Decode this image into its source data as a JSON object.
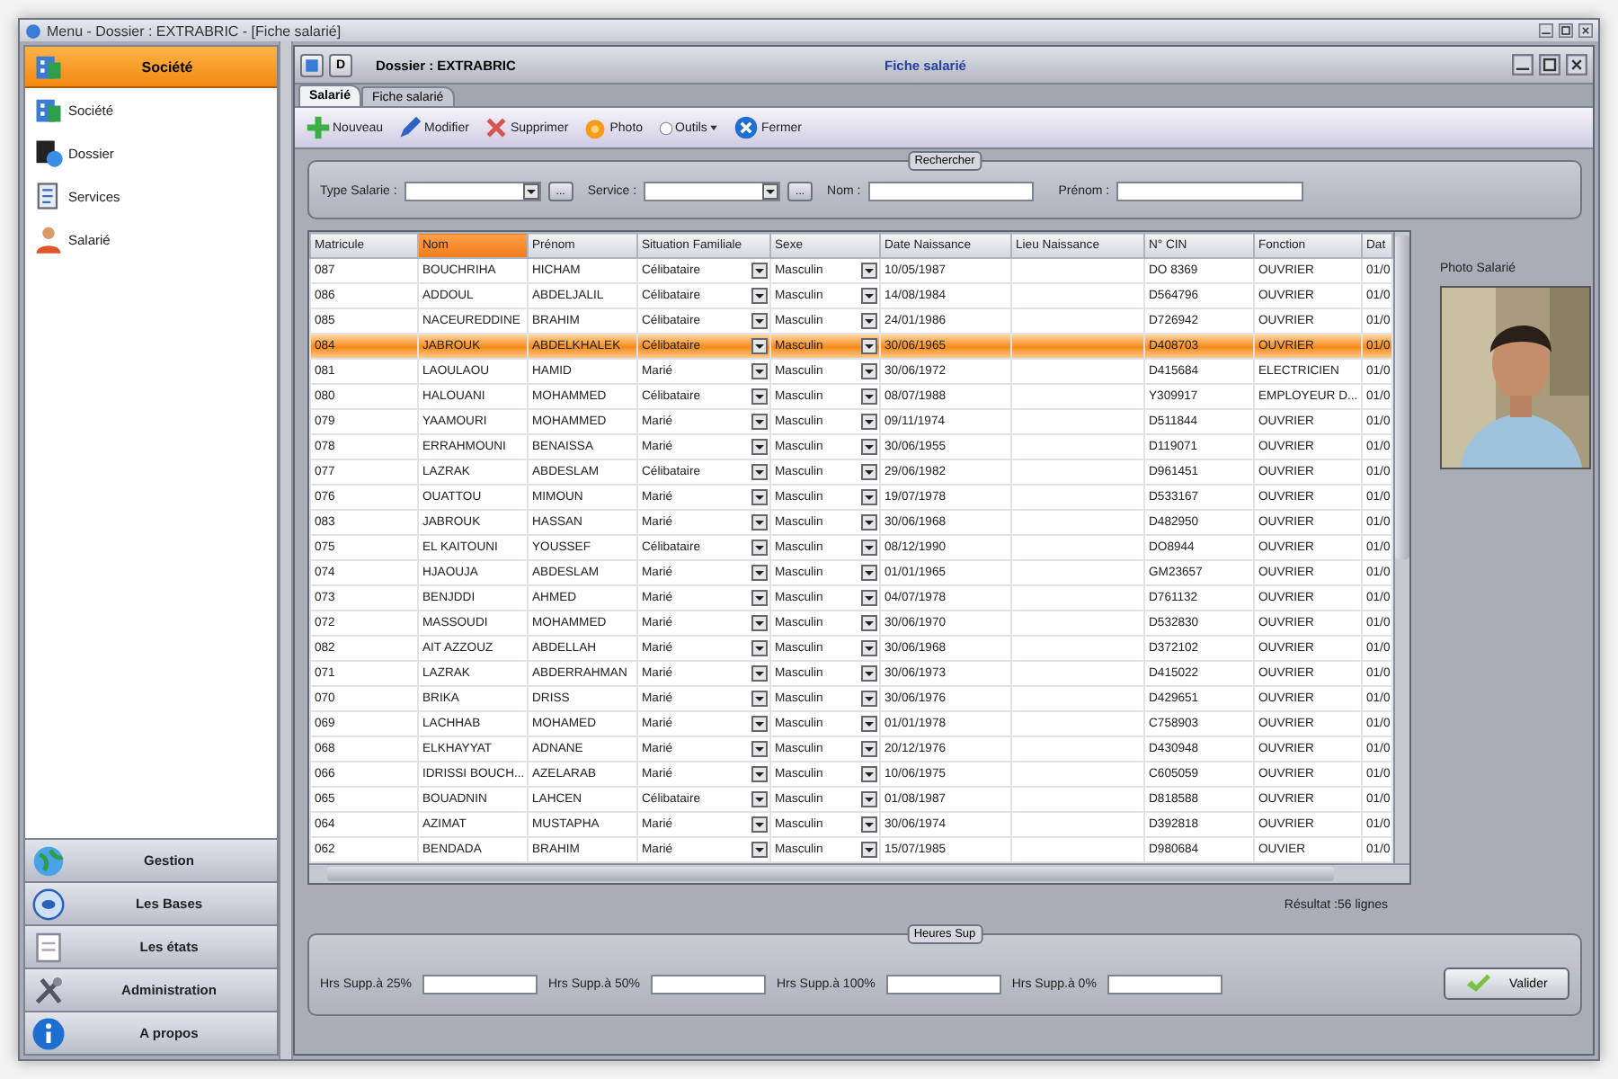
{
  "window": {
    "title": "Menu - Dossier : EXTRABRIC - [Fiche salarié]"
  },
  "sidebar": {
    "header": {
      "label": "Société",
      "selected": true
    },
    "items": [
      "Société",
      "Dossier",
      "Services",
      "Salarié"
    ],
    "nav": [
      "Gestion",
      "Les Bases",
      "Les états",
      "Administration",
      "A propos"
    ]
  },
  "document": {
    "button": "D",
    "dossier": "Dossier : EXTRABRIC",
    "title": "Fiche salarié"
  },
  "tabs": [
    {
      "label": "Salarié",
      "selected": true
    },
    {
      "label": "Fiche salarié",
      "selected": false
    }
  ],
  "toolbar": [
    {
      "label": "Nouveau",
      "kind": "button"
    },
    {
      "label": "Modifier",
      "kind": "button"
    },
    {
      "label": "Supprimer",
      "kind": "button"
    },
    {
      "label": "Photo",
      "kind": "button"
    },
    {
      "label": "Outils",
      "kind": "menu"
    },
    {
      "label": "Fermer",
      "kind": "button"
    }
  ],
  "search": {
    "title": "Rechercher",
    "fields": [
      {
        "label": "Type Salarie :",
        "kind": "combo",
        "browse": "..."
      },
      {
        "label": "Service :",
        "kind": "combo",
        "browse": "..."
      },
      {
        "label": "Nom :",
        "kind": "text"
      },
      {
        "label": "Prénom :",
        "kind": "text"
      }
    ]
  },
  "table": {
    "columns": [
      {
        "label": "Matricule",
        "sorted": false,
        "kind": "text"
      },
      {
        "label": "Nom",
        "sorted": true,
        "kind": "text"
      },
      {
        "label": "Prénom",
        "sorted": false,
        "kind": "text"
      },
      {
        "label": "Situation Familiale",
        "sorted": false,
        "kind": "combo"
      },
      {
        "label": "Sexe",
        "sorted": false,
        "kind": "combo"
      },
      {
        "label": "Date Naissance",
        "sorted": false,
        "kind": "text"
      },
      {
        "label": "Lieu Naissance",
        "sorted": false,
        "kind": "text"
      },
      {
        "label": "N° CIN",
        "sorted": false,
        "kind": "text"
      },
      {
        "label": "Fonction",
        "sorted": false,
        "kind": "text"
      },
      {
        "label": "Dat",
        "sorted": false,
        "kind": "text"
      }
    ],
    "rows": [
      {
        "selected": false,
        "cells": [
          "087",
          "BOUCHRIHA",
          "HICHAM",
          "Célibataire",
          "Masculin",
          "10/05/1987",
          "",
          "DO 8369",
          "OUVRIER",
          "01/0"
        ]
      },
      {
        "selected": false,
        "cells": [
          "086",
          "ADDOUL",
          "ABDELJALIL",
          "Célibataire",
          "Masculin",
          "14/08/1984",
          "",
          "D564796",
          "OUVRIER",
          "01/0"
        ]
      },
      {
        "selected": false,
        "cells": [
          "085",
          "NACEUREDDINE",
          "BRAHIM",
          "Célibataire",
          "Masculin",
          "24/01/1986",
          "",
          "D726942",
          "OUVRIER",
          "01/0"
        ]
      },
      {
        "selected": true,
        "cells": [
          "084",
          "JABROUK",
          "ABDELKHALEK",
          "Célibataire",
          "Masculin",
          "30/06/1965",
          "",
          "D408703",
          "OUVRIER",
          "01/0"
        ]
      },
      {
        "selected": false,
        "cells": [
          "081",
          "LAOULAOU",
          "HAMID",
          "Marié",
          "Masculin",
          "30/06/1972",
          "",
          "D415684",
          "ELECTRICIEN",
          "01/0"
        ]
      },
      {
        "selected": false,
        "cells": [
          "080",
          "HALOUANI",
          "MOHAMMED",
          "Célibataire",
          "Masculin",
          "08/07/1988",
          "",
          "Y309917",
          "EMPLOYEUR D...",
          "01/0"
        ]
      },
      {
        "selected": false,
        "cells": [
          "079",
          "YAAMOURI",
          "MOHAMMED",
          "Marié",
          "Masculin",
          "09/11/1974",
          "",
          "D511844",
          "OUVRIER",
          "01/0"
        ]
      },
      {
        "selected": false,
        "cells": [
          "078",
          "ERRAHMOUNI",
          "BENAISSA",
          "Marié",
          "Masculin",
          "30/06/1955",
          "",
          "D119071",
          "OUVRIER",
          "01/0"
        ]
      },
      {
        "selected": false,
        "cells": [
          "077",
          "LAZRAK",
          "ABDESLAM",
          "Célibataire",
          "Masculin",
          "29/06/1982",
          "",
          "D961451",
          "OUVRIER",
          "01/0"
        ]
      },
      {
        "selected": false,
        "cells": [
          "076",
          "OUATTOU",
          "MIMOUN",
          "Marié",
          "Masculin",
          "19/07/1978",
          "",
          "D533167",
          "OUVRIER",
          "01/0"
        ]
      },
      {
        "selected": false,
        "cells": [
          "083",
          "JABROUK",
          "HASSAN",
          "Marié",
          "Masculin",
          "30/06/1968",
          "",
          "D482950",
          "OUVRIER",
          "01/0"
        ]
      },
      {
        "selected": false,
        "cells": [
          "075",
          "EL KAITOUNI",
          "YOUSSEF",
          "Célibataire",
          "Masculin",
          "08/12/1990",
          "",
          "DO8944",
          "OUVRIER",
          "01/0"
        ]
      },
      {
        "selected": false,
        "cells": [
          "074",
          "HJAOUJA",
          "ABDESLAM",
          "Marié",
          "Masculin",
          "01/01/1965",
          "",
          "GM23657",
          "OUVRIER",
          "01/0"
        ]
      },
      {
        "selected": false,
        "cells": [
          "073",
          "BENJDDI",
          "AHMED",
          "Marié",
          "Masculin",
          "04/07/1978",
          "",
          "D761132",
          "OUVRIER",
          "01/0"
        ]
      },
      {
        "selected": false,
        "cells": [
          "072",
          "MASSOUDI",
          "MOHAMMED",
          "Marié",
          "Masculin",
          "30/06/1970",
          "",
          "D532830",
          "OUVRIER",
          "01/0"
        ]
      },
      {
        "selected": false,
        "cells": [
          "082",
          "AIT AZZOUZ",
          "ABDELLAH",
          "Marié",
          "Masculin",
          "30/06/1968",
          "",
          "D372102",
          "OUVRIER",
          "01/0"
        ]
      },
      {
        "selected": false,
        "cells": [
          "071",
          "LAZRAK",
          "ABDERRAHMAN",
          "Marié",
          "Masculin",
          "30/06/1973",
          "",
          "D415022",
          "OUVRIER",
          "01/0"
        ]
      },
      {
        "selected": false,
        "cells": [
          "070",
          "BRIKA",
          "DRISS",
          "Marié",
          "Masculin",
          "30/06/1976",
          "",
          "D429651",
          "OUVRIER",
          "01/0"
        ]
      },
      {
        "selected": false,
        "cells": [
          "069",
          "LACHHAB",
          "MOHAMED",
          "Marié",
          "Masculin",
          "01/01/1978",
          "",
          "C758903",
          "OUVRIER",
          "01/0"
        ]
      },
      {
        "selected": false,
        "cells": [
          "068",
          "ELKHAYYAT",
          "ADNANE",
          "Marié",
          "Masculin",
          "20/12/1976",
          "",
          "D430948",
          "OUVRIER",
          "01/0"
        ]
      },
      {
        "selected": false,
        "cells": [
          "066",
          "IDRISSI BOUCH...",
          "AZELARAB",
          "Marié",
          "Masculin",
          "10/06/1975",
          "",
          "C605059",
          "OUVRIER",
          "01/0"
        ]
      },
      {
        "selected": false,
        "cells": [
          "065",
          "BOUADNIN",
          "LAHCEN",
          "Célibataire",
          "Masculin",
          "01/08/1987",
          "",
          "D818588",
          "OUVRIER",
          "01/0"
        ]
      },
      {
        "selected": false,
        "cells": [
          "064",
          "AZIMAT",
          "MUSTAPHA",
          "Marié",
          "Masculin",
          "30/06/1974",
          "",
          "D392818",
          "OUVRIER",
          "01/0"
        ]
      },
      {
        "selected": false,
        "cells": [
          "062",
          "BENDADA",
          "BRAHIM",
          "Marié",
          "Masculin",
          "15/07/1985",
          "",
          "D980684",
          "OUVIER",
          "01/0"
        ]
      }
    ]
  },
  "photo": {
    "label": "Photo Salarié",
    "kind": "picture"
  },
  "result": "Résultat :56 lignes",
  "overtime": {
    "title": "Heures Sup",
    "fields": [
      "Hrs Supp.à 25%",
      "Hrs Supp.à 50%",
      "Hrs Supp.à 100%",
      "Hrs Supp.à 0%"
    ],
    "submit": "Valider"
  }
}
